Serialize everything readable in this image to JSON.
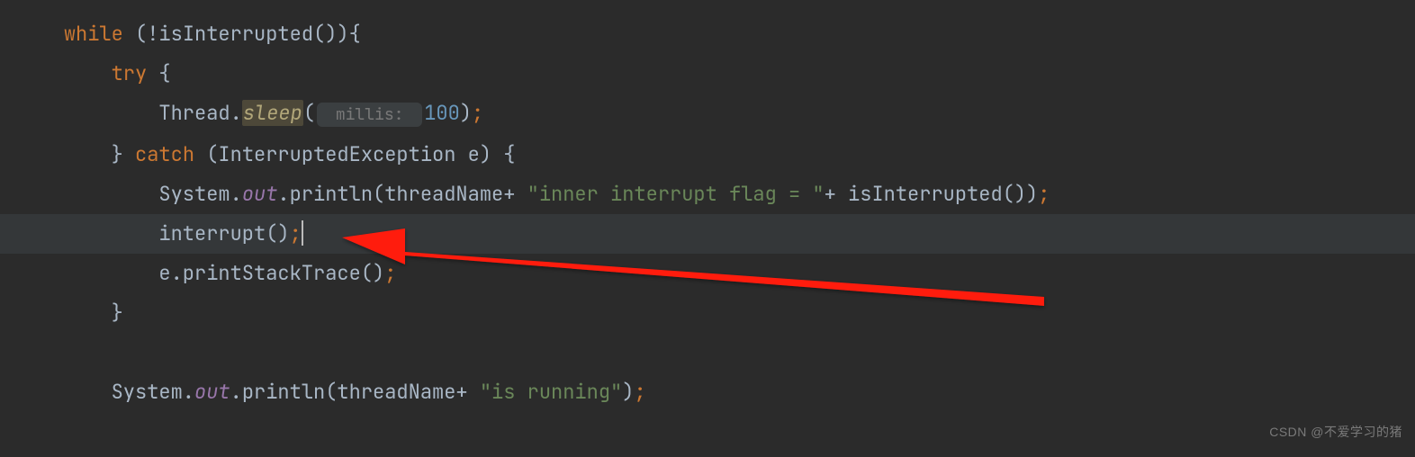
{
  "line1": {
    "kw_while": "while",
    "cond_prefix": " (!isInterrupted()){"
  },
  "line2": {
    "kw_try": "try",
    "brace": " {"
  },
  "line3": {
    "thread": "Thread.",
    "sleep": "sleep",
    "open": "(",
    "hint": " millis: ",
    "num": "100",
    "close": ")",
    "semi": ";"
  },
  "line4": {
    "close_brace": "} ",
    "kw_catch": "catch",
    "params": " (InterruptedException e) {"
  },
  "line5": {
    "sys": "System.",
    "out": "out",
    "print": ".println(threadName+ ",
    "str": "\"inner interrupt flag = \"",
    "plus": "+ isInterrupted())",
    "semi": ";"
  },
  "line6": {
    "interrupt": "interrupt()",
    "semi": ";"
  },
  "line7": {
    "stack": "e.printStackTrace()",
    "semi": ";"
  },
  "line8": {
    "brace": "}"
  },
  "line9": {
    "sys": "System.",
    "out": "out",
    "print": ".println(threadName+ ",
    "str": "\"is running\"",
    "close": ")",
    "semi": ";"
  },
  "watermark": "CSDN @不爱学习的猪"
}
